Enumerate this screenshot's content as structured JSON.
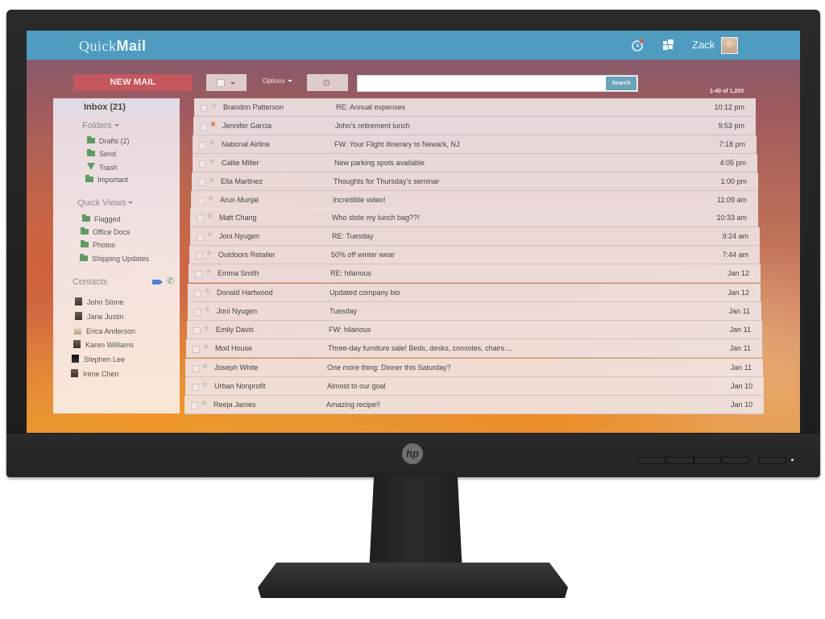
{
  "app": {
    "logo_light": "Quick",
    "logo_bold": "Mail",
    "user_name": "Zack",
    "header_icons": [
      "notifications-clock-icon",
      "apps-grid-icon"
    ]
  },
  "toolbar": {
    "new_mail_label": "NEW MAIL",
    "options_label": "Options",
    "search_placeholder": "",
    "search_button_label": "Search",
    "pagination": "1-40 of 1,203"
  },
  "sidebar": {
    "inbox_label": "Inbox (21)",
    "folders_label": "Folders",
    "folders": [
      {
        "label": "Drafts (2)",
        "icon": "folder-icon"
      },
      {
        "label": "Send",
        "icon": "folder-icon"
      },
      {
        "label": "Trash",
        "icon": "trash-icon"
      },
      {
        "label": "Important",
        "icon": "important-folder-icon"
      }
    ],
    "quick_views_label": "Quick Views",
    "quick_views": [
      {
        "label": "Flagged"
      },
      {
        "label": "Office Docs"
      },
      {
        "label": "Photos"
      },
      {
        "label": "Shipping Updates"
      }
    ],
    "contacts_label": "Contacts",
    "contacts": [
      {
        "name": "John Stone"
      },
      {
        "name": "Jane Justin"
      },
      {
        "name": "Erica Anderson"
      },
      {
        "name": "Karen Williams"
      },
      {
        "name": "Stephen Lee"
      },
      {
        "name": "Irene Chen"
      }
    ]
  },
  "emails": [
    {
      "from": "Brandon Patterson",
      "subject": "RE: Annual expenses",
      "time": "10:12 pm",
      "starred": false
    },
    {
      "from": "Jennifer Garcia",
      "subject": "John's retirement lunch",
      "time": "9:53 pm",
      "starred": true
    },
    {
      "from": "National Airline",
      "subject": "FW: Your Flight Itinerary to Newark, NJ",
      "time": "7:18 pm",
      "starred": false
    },
    {
      "from": "Callie Miller",
      "subject": "New parking spots available",
      "time": "4:05 pm",
      "starred": false
    },
    {
      "from": "Ella Martinez",
      "subject": "Thoughts for Thursday's seminar",
      "time": "1:00 pm",
      "starred": false
    },
    {
      "from": "Arun Munjal",
      "subject": "Incredible video!",
      "time": "11:09 am",
      "starred": false
    },
    {
      "from": "Matt Chang",
      "subject": "Who stole my lunch bag??!",
      "time": "10:33 am",
      "starred": false
    },
    {
      "from": "Joni Nyugen",
      "subject": "RE: Tuesday",
      "time": "9:24 am",
      "starred": false
    },
    {
      "from": "Outdoors Retailer",
      "subject": "50% off winter wear",
      "time": "7:44 am",
      "starred": false
    },
    {
      "from": "Emma Smith",
      "subject": "RE: hilarious",
      "time": "Jan 12",
      "starred": false
    },
    {
      "from": "Donald Hartwood",
      "subject": "Updated company bio",
      "time": "Jan 12",
      "starred": false
    },
    {
      "from": "Joni Nyugen",
      "subject": "Tuesday",
      "time": "Jan 11",
      "starred": false
    },
    {
      "from": "Emily Davis",
      "subject": "FW: hilarious",
      "time": "Jan 11",
      "starred": false
    },
    {
      "from": "Mod House",
      "subject": "Three-day furniture sale! Beds, desks, consoles, chairs ...",
      "time": "Jan 11",
      "starred": false
    },
    {
      "from": "Joseph White",
      "subject": "One more thing: Dinner this Saturday?",
      "time": "Jan 11",
      "starred": false
    },
    {
      "from": "Urban Nonprofit",
      "subject": "Almost to our goal",
      "time": "Jan 10",
      "starred": false
    },
    {
      "from": "Reeja James",
      "subject": "Amazing recipe!!",
      "time": "Jan 10",
      "starred": false
    }
  ],
  "monitor": {
    "brand": "hp",
    "colors": {
      "app_bar": "#4f9cc0",
      "new_mail": "#c4565e",
      "search_button": "#6ba3b7",
      "folder": "#5e9a63",
      "star_active": "#d47b3b"
    }
  }
}
